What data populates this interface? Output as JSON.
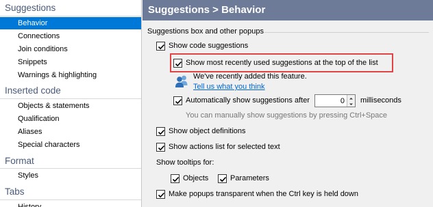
{
  "sidebar": {
    "sections": [
      {
        "title": "Suggestions",
        "items": [
          "Behavior",
          "Connections",
          "Join conditions",
          "Snippets",
          "Warnings & highlighting"
        ]
      },
      {
        "title": "Inserted code",
        "items": [
          "Objects & statements",
          "Qualification",
          "Aliases",
          "Special characters"
        ]
      },
      {
        "title": "Format",
        "items": [
          "Styles"
        ]
      },
      {
        "title": "Tabs",
        "items": [
          "History"
        ]
      }
    ],
    "selected": "Behavior"
  },
  "panel": {
    "title": "Suggestions > Behavior",
    "group_label": "Suggestions box and other popups",
    "show_code_suggestions": {
      "label": "Show code suggestions",
      "checked": true
    },
    "show_recent_top": {
      "label": "Show most recently used suggestions at the top of the list",
      "checked": true
    },
    "info": {
      "text": "We've recently added this feature.",
      "link": "Tell us what you think"
    },
    "auto_show": {
      "label": "Automatically show suggestions after",
      "checked": true,
      "value": "0",
      "unit": "milliseconds"
    },
    "hint": "You can manually show suggestions by pressing Ctrl+Space",
    "show_object_definitions": {
      "label": "Show object definitions",
      "checked": true
    },
    "show_actions_list": {
      "label": "Show actions list for selected text",
      "checked": true
    },
    "tooltips_label": "Show tooltips for:",
    "tooltips_objects": {
      "label": "Objects",
      "checked": true
    },
    "tooltips_parameters": {
      "label": "Parameters",
      "checked": true
    },
    "transparent_popups": {
      "label": "Make popups transparent when the Ctrl key is held down",
      "checked": true
    }
  },
  "colors": {
    "accent": "#0078d7",
    "title_bar": "#6e7b98",
    "section_header": "#4a5a78",
    "highlight": "#e04444",
    "link": "#0066cc"
  },
  "icons": {
    "info": "users-icon",
    "check": "checkmark-icon",
    "spin_up": "chevron-up-icon",
    "spin_down": "chevron-down-icon"
  }
}
